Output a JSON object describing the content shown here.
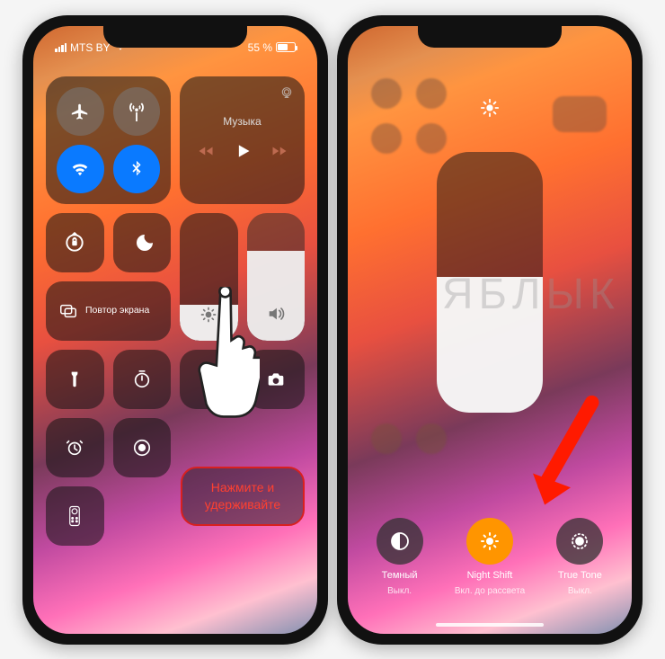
{
  "watermark": "ЯБЛЫК",
  "phone1": {
    "status": {
      "carrier": "MTS BY",
      "battery_pct": "55 %"
    },
    "connectivity": {
      "airplane": {
        "on": false
      },
      "cellular": {
        "on": true
      },
      "wifi": {
        "on": true
      },
      "bluetooth": {
        "on": true
      }
    },
    "music": {
      "label": "Музыка"
    },
    "screen_mirror_label": "Повтор экрана",
    "brightness_pct": 28,
    "volume_pct": 70,
    "hint_text": "Нажмите и удерживайте"
  },
  "phone2": {
    "brightness_pct": 52,
    "modes": {
      "dark": {
        "title": "Темный",
        "subtitle": "Выкл.",
        "active": false
      },
      "night": {
        "title": "Night Shift",
        "subtitle": "Вкл. до рассвета",
        "active": true
      },
      "tone": {
        "title": "True Tone",
        "subtitle": "Выкл.",
        "active": false
      }
    }
  },
  "icons": {
    "airplane": "airplane-icon",
    "cellular": "cellular-antenna-icon",
    "wifi": "wifi-icon",
    "bluetooth": "bluetooth-icon",
    "airplay": "airplay-icon",
    "prev": "previous-track-icon",
    "play": "play-icon",
    "next": "next-track-icon",
    "lock_rotate": "rotation-lock-icon",
    "moon": "do-not-disturb-icon",
    "sun": "brightness-icon",
    "speaker": "volume-icon",
    "mirror": "screen-mirroring-icon",
    "flashlight": "flashlight-icon",
    "timer": "timer-icon",
    "calc": "calculator-icon",
    "camera": "camera-icon",
    "alarm": "alarm-icon",
    "record": "screen-record-icon",
    "remote": "apple-tv-remote-icon",
    "contrast": "dark-mode-icon",
    "night_shift": "night-shift-icon",
    "true_tone": "true-tone-icon"
  }
}
